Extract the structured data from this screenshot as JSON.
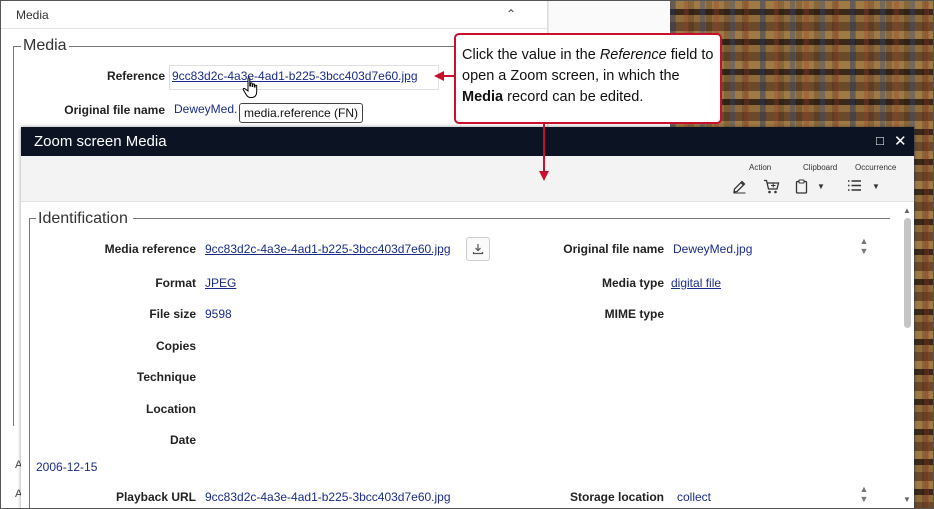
{
  "background": {
    "panel_title": "Media",
    "legend": "Media",
    "reference_label": "Reference",
    "reference_value": "9cc83d2c-4a3e-4ad1-b225-3bcc403d7e60.jpg",
    "original_file_label": "Original file name",
    "original_file_value": "DeweyMed.",
    "tooltip": "media.reference (FN)",
    "left_letters": [
      "A",
      "A"
    ]
  },
  "callout": {
    "text_1": "Click the value in the ",
    "text_italic": "Reference",
    "text_2": " field to open a Zoom screen, in which the ",
    "text_bold": "Media",
    "text_3": " record can be edited."
  },
  "zoom": {
    "title": "Zoom screen Media",
    "maximize_icon": "maximize-icon",
    "close_icon": "close-icon",
    "toolbar": {
      "action_label": "Action",
      "clipboard_label": "Clipboard",
      "occurrence_label": "Occurrence",
      "edit_icon": "edit-icon",
      "cart_icon": "cart-icon",
      "clipboard_icon": "clipboard-icon",
      "list_icon": "list-icon"
    },
    "section_legend": "Identification",
    "fields": {
      "media_reference_label": "Media reference",
      "media_reference_value": "9cc83d2c-4a3e-4ad1-b225-3bcc403d7e60.jpg",
      "original_file_name_label": "Original file name",
      "original_file_name_value": "DeweyMed.jpg",
      "format_label": "Format",
      "format_value": "JPEG",
      "media_type_label": "Media type",
      "media_type_value": "digital file",
      "file_size_label": "File size",
      "file_size_value": "9598",
      "mime_type_label": "MIME type",
      "copies_label": "Copies",
      "technique_label": "Technique",
      "location_label": "Location",
      "date_label": "Date",
      "date_value": "2006-12-15",
      "playback_url_label": "Playback URL",
      "playback_url_value": "9cc83d2c-4a3e-4ad1-b225-3bcc403d7e60.jpg",
      "storage_location_label": "Storage location",
      "storage_location_value": "collect"
    }
  }
}
